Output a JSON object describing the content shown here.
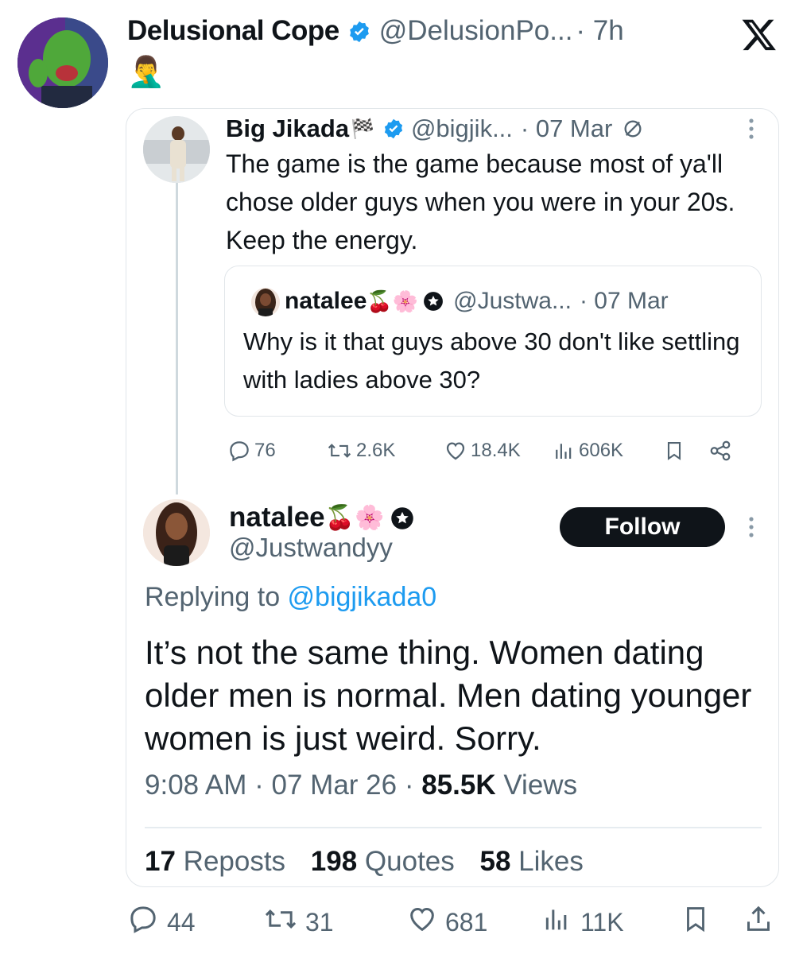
{
  "outer": {
    "name": "Delusional Cope",
    "handle": "@DelusionPo...",
    "time": "· 7h",
    "emoji": "🤦‍♂️"
  },
  "quoted": {
    "name": "Big Jikada",
    "name_emoji": "🏁",
    "handle": "@bigjik...",
    "date": "· 07 Mar",
    "text": "The game is the game because most of ya'll chose older guys when you were in your 20s. Keep the energy.",
    "nested": {
      "name": "natalee",
      "name_emoji": "🍒🌸",
      "handle": "@Justwa...",
      "date": "· 07 Mar",
      "text": "Why is it that guys above 30 don't like settling with ladies above 30?"
    },
    "actions": {
      "replies": "76",
      "reposts": "2.6K",
      "likes": "18.4K",
      "views": "606K"
    }
  },
  "main": {
    "name": "natalee",
    "name_emoji": "🍒🌸",
    "handle": "@Justwandyy",
    "follow_label": "Follow",
    "replying_prefix": "Replying to ",
    "replying_to": "@bigjikada0",
    "text": "It’s not the same thing. Women dating older men is normal. Men dating younger women is just weird. Sorry.",
    "time": "9:08 AM · 07 Mar 26 · ",
    "views_count": "85.5K",
    "views_label": " Views",
    "reposts_count": "17",
    "reposts_label": " Reposts",
    "quotes_count": "198",
    "quotes_label": " Quotes",
    "likes_count": "58",
    "likes_label": " Likes"
  },
  "bottom_bar": {
    "replies": "44",
    "reposts": "31",
    "likes": "681",
    "views": "11K"
  },
  "colors": {
    "verified_blue": "#1d9bf0",
    "text": "#0f1419",
    "muted": "#536471",
    "link": "#1d9bf0"
  }
}
